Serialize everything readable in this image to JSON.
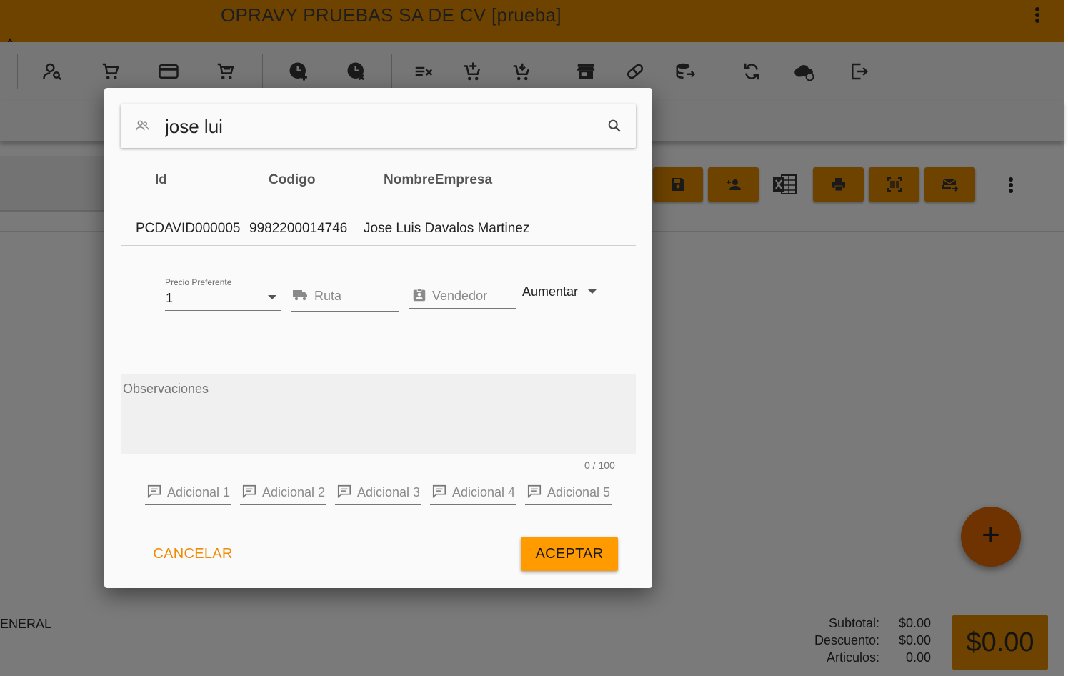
{
  "app": {
    "title": "OPRAVY PRUEBAS SA DE CV [prueba]",
    "warning_icon": "warning-icon",
    "menu_icon": "more-vert-icon"
  },
  "toolbar": {
    "icons": [
      "person-search-icon",
      "cart-icon",
      "credit-card-icon",
      "cart-outline-icon",
      "clock-add-icon",
      "clock-cancel-icon",
      "playlist-remove-icon",
      "cart-plus-icon",
      "cart-arrow-icon",
      "store-icon",
      "pill-icon",
      "database-arrow-icon",
      "sync-icon",
      "cloud-sync-icon",
      "logout-icon"
    ]
  },
  "actions": {
    "icons": [
      "save-icon",
      "person-add-icon",
      "excel-icon",
      "print-icon",
      "barcode-scan-icon",
      "email-send-icon",
      "more-vert-icon"
    ]
  },
  "background": {
    "client_label": "ENERAL",
    "totals": [
      {
        "label": "Subtotal:",
        "value": "$0.00"
      },
      {
        "label": "Descuento:",
        "value": "$0.00"
      },
      {
        "label": "Articulos:",
        "value": "0.00"
      }
    ],
    "grand_total": "$0.00",
    "fab_label": "+"
  },
  "dialog": {
    "search": {
      "value": "jose lui",
      "left_icon": "people-icon",
      "right_icon": "search-icon"
    },
    "table": {
      "headers": [
        "Id",
        "Codigo",
        "NombreEmpresa"
      ],
      "rows": [
        [
          "PCDAVID000005",
          "9982200014746",
          "Jose Luis Davalos Martinez"
        ]
      ]
    },
    "precio": {
      "label": "Precio Preferente",
      "value": "1"
    },
    "ruta": {
      "placeholder": "Ruta",
      "icon": "truck-icon"
    },
    "vendedor": {
      "placeholder": "Vendedor",
      "icon": "badge-icon"
    },
    "ajuste": {
      "value": "Aumentar"
    },
    "observaciones": {
      "placeholder": "Observaciones",
      "counter": "0 / 100"
    },
    "adicionales": [
      "Adicional 1",
      "Adicional 2",
      "Adicional 3",
      "Adicional 4",
      "Adicional 5"
    ],
    "buttons": {
      "cancel": "CANCELAR",
      "accept": "ACEPTAR"
    },
    "colors": {
      "accent": "#ff9a00",
      "cancel_text": "#f08a00"
    }
  }
}
